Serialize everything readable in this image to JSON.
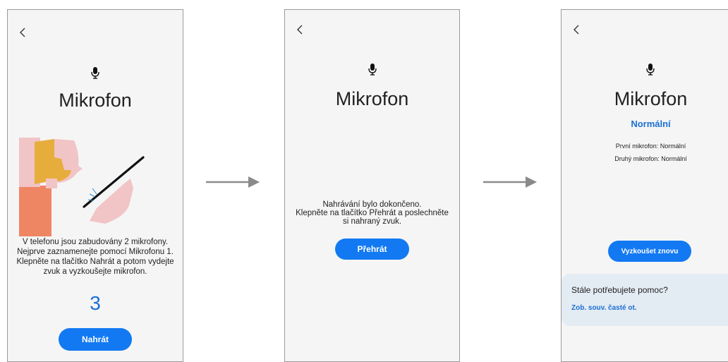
{
  "screen1": {
    "title": "Mikrofon",
    "instructions_line1": "V telefonu jsou zabudovány 2 mikrofony.",
    "instructions_line2": "Nejprve zaznamenejte pomocí Mikrofonu 1.",
    "instructions_line3": "Klepněte na tlačítko Nahrát a potom vydejte",
    "instructions_line4": "zvuk a vyzkoušejte mikrofon.",
    "countdown": "3",
    "record_button": "Nahrát"
  },
  "screen2": {
    "title": "Mikrofon",
    "message_line1": "Nahrávání bylo dokončeno.",
    "message_line2": "Klepněte na tlačítko Přehrát a poslechněte",
    "message_line3": "si nahraný zvuk.",
    "play_button": "Přehrát"
  },
  "screen3": {
    "title": "Mikrofon",
    "status": "Normální",
    "mic1_result": "První mikrofon: Normální",
    "mic2_result": "Druhý mikrofon: Normální",
    "retry_button": "Vyzkoušet znovu",
    "help_question": "Stále potřebujete pomoc?",
    "help_link": "Zob. souv. časté ot."
  },
  "icons": {
    "back": "chevron-left-icon",
    "mic": "microphone-icon",
    "arrow": "arrow-right-icon"
  },
  "colors": {
    "accent": "#1279f2",
    "link": "#1a6fd3",
    "screen_bg": "#f5f5f5",
    "card_bg": "#e3ebf3"
  }
}
